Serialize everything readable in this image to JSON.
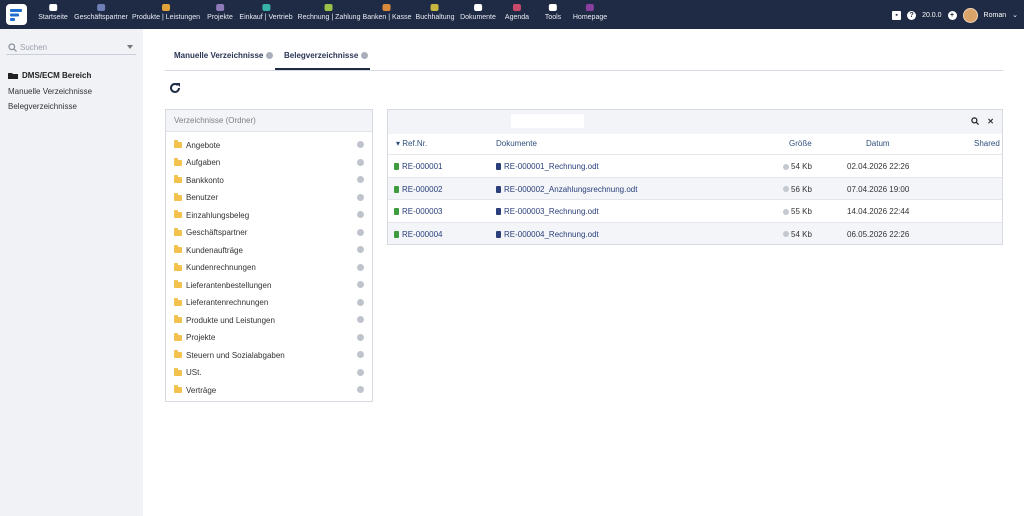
{
  "nav": {
    "items": [
      {
        "label": "Startseite",
        "icon": "home-icon",
        "color": "#ffffff"
      },
      {
        "label": "Geschäftspartner",
        "icon": "contacts-icon",
        "color": "#6e7fb5"
      },
      {
        "label": "Produkte | Leistungen",
        "icon": "box-icon",
        "color": "#e2a33a"
      },
      {
        "label": "Projekte",
        "icon": "network-icon",
        "color": "#8e7ab8"
      },
      {
        "label": "Einkauf | Vertrieb",
        "icon": "cart-icon",
        "color": "#38b2a8"
      },
      {
        "label": "Rechnung | Zahlung",
        "icon": "invoice-icon",
        "color": "#9bc24a"
      },
      {
        "label": "Banken | Kasse",
        "icon": "bank-icon",
        "color": "#d98a3a"
      },
      {
        "label": "Buchhaltung",
        "icon": "magnifier-icon",
        "color": "#c8b640"
      },
      {
        "label": "Dokumente",
        "icon": "folder-icon",
        "color": "#ffffff"
      },
      {
        "label": "Agenda",
        "icon": "calendar-icon",
        "color": "#c94a6a"
      },
      {
        "label": "Tools",
        "icon": "tools-icon",
        "color": "#ffffff"
      },
      {
        "label": "Homepage",
        "icon": "globe-icon",
        "color": "#8a3fa0"
      }
    ],
    "version": "20.0.0",
    "user": "Roman"
  },
  "sidebar": {
    "search_placeholder": "Suchen",
    "section": "DMS/ECM Bereich",
    "links": [
      "Manuelle Verzeichnisse",
      "Belegverzeichnisse"
    ]
  },
  "tabs": [
    {
      "label": "Manuelle Verzeichnisse",
      "active": false
    },
    {
      "label": "Belegverzeichnisse",
      "active": true
    }
  ],
  "folders": {
    "header": "Verzeichnisse (Ordner)",
    "items": [
      "Angebote",
      "Aufgaben",
      "Bankkonto",
      "Benutzer",
      "Einzahlungsbeleg",
      "Geschäftspartner",
      "Kundenaufträge",
      "Kundenrechnungen",
      "Lieferantenbestellungen",
      "Lieferantenrechnungen",
      "Produkte und Leistungen",
      "Projekte",
      "Steuern und Sozialabgaben",
      "USt.",
      "Verträge"
    ]
  },
  "table": {
    "columns": {
      "ref": "Ref.Nr.",
      "docs": "Dokumente",
      "size": "Größe",
      "date": "Datum",
      "shared": "Shared"
    },
    "rows": [
      {
        "ref": "RE-000001",
        "doc": "RE-000001_Rechnung.odt",
        "size": "54 Kb",
        "date": "02.04.2026 22:26"
      },
      {
        "ref": "RE-000002",
        "doc": "RE-000002_Anzahlungsrechnung.odt",
        "size": "56 Kb",
        "date": "07.04.2026 19:00"
      },
      {
        "ref": "RE-000003",
        "doc": "RE-000003_Rechnung.odt",
        "size": "55 Kb",
        "date": "14.04.2026 22:44"
      },
      {
        "ref": "RE-000004",
        "doc": "RE-000004_Rechnung.odt",
        "size": "54 Kb",
        "date": "06.05.2026 22:26"
      }
    ],
    "search_icon": "search-icon",
    "close_icon": "close-icon"
  },
  "colors": {
    "topbar": "#1f2a44",
    "accent": "#2a3f7a"
  }
}
